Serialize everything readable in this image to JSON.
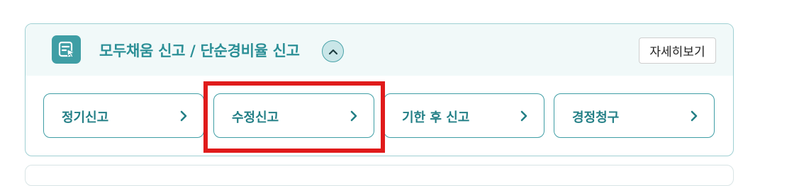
{
  "panel": {
    "title": "모두채움 신고 / 단순경비율 신고",
    "header_icon": "document-cursor-icon",
    "toggle_icon": "chevron-up-icon",
    "detail_button_label": "자세히보기"
  },
  "buttons": [
    {
      "label": "정기신고",
      "icon": "chevron-right-icon"
    },
    {
      "label": "수정신고",
      "icon": "chevron-right-icon",
      "highlighted": true
    },
    {
      "label": "기한 후 신고",
      "icon": "chevron-right-icon"
    },
    {
      "label": "경정청구",
      "icon": "chevron-right-icon"
    }
  ],
  "colors": {
    "accent": "#2b8f96",
    "header_bg": "#f1f9f9",
    "border": "#9fd0d3",
    "highlight": "#e01b1b"
  }
}
